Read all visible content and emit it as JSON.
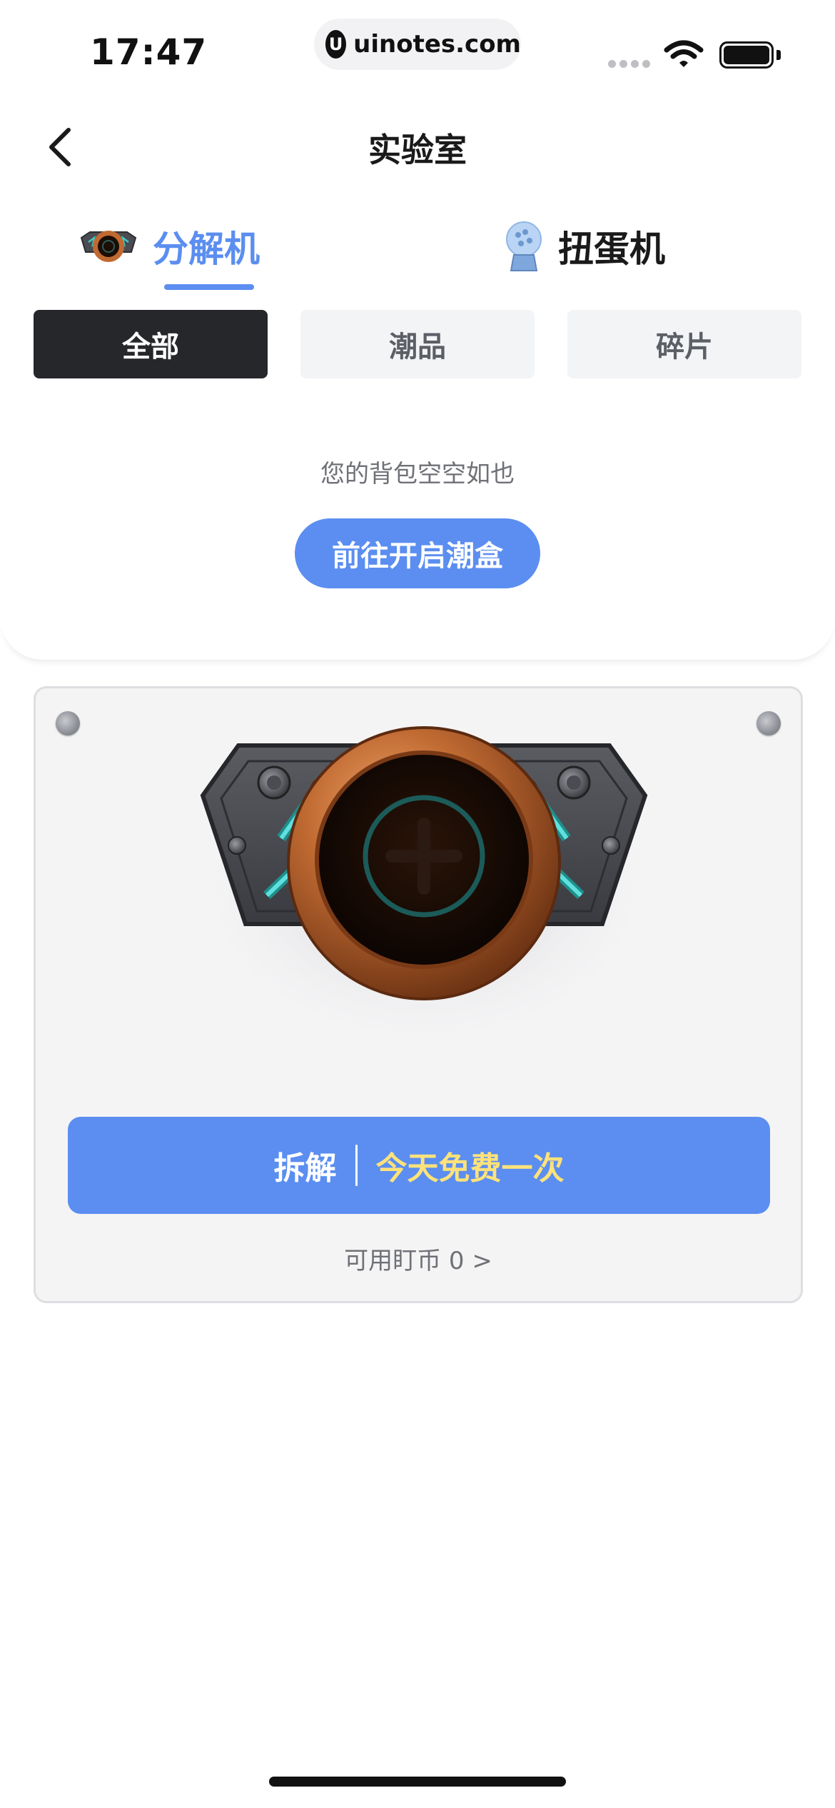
{
  "status_bar": {
    "time": "17:47",
    "watermark_logo": "U",
    "watermark": "uinotes.com",
    "icons": [
      "signal-icon",
      "wifi-icon",
      "battery-icon"
    ]
  },
  "header": {
    "title": "实验室",
    "back_icon": "chevron-left-icon"
  },
  "machine_tabs": [
    {
      "label": "分解机",
      "icon": "decomposer-machine-icon",
      "active": true
    },
    {
      "label": "扭蛋机",
      "icon": "gacha-capsule-icon",
      "active": false
    }
  ],
  "filters": [
    {
      "label": "全部",
      "active": true
    },
    {
      "label": "潮品",
      "active": false
    },
    {
      "label": "碎片",
      "active": false
    }
  ],
  "empty_state": {
    "message": "您的背包空空如也",
    "button_label": "前往开启潮盒"
  },
  "machine_panel": {
    "illustration": "decomposer-machine",
    "action_label": "拆解",
    "free_label": "今天免费一次",
    "coins_text": "可用盯币 0 >"
  },
  "colors": {
    "accent": "#5b8ef0",
    "active_chip": "#26272b",
    "free_text": "#ffe27a",
    "copper": "#c06a32"
  }
}
